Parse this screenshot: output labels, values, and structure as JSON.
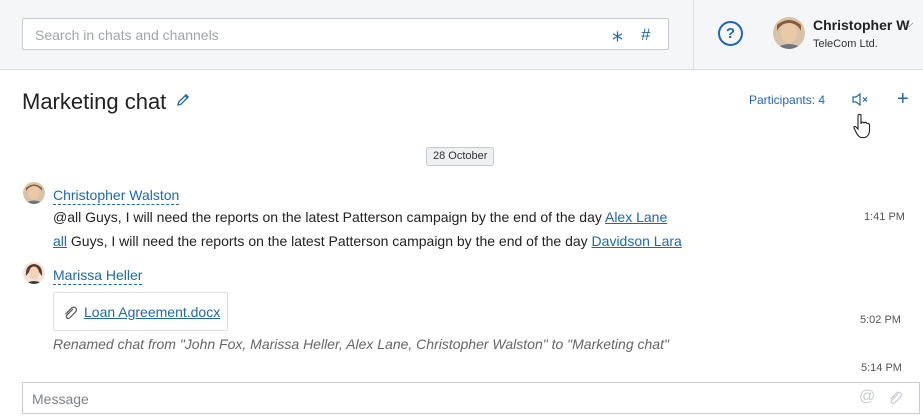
{
  "search": {
    "placeholder": "Search in chats and channels"
  },
  "user": {
    "name": "Christopher W",
    "company": "TeleCom Ltd."
  },
  "chat": {
    "title": "Marketing chat",
    "participants_label": "Participants: 4"
  },
  "date_separator": "28 October",
  "messages": [
    {
      "author": "Christopher Walston",
      "lines": [
        {
          "text": "@all Guys, I will need the reports on the latest Patterson campaign by the end of the day ",
          "mention": "Alex Lane",
          "time": "1:41 PM"
        },
        {
          "lead_mention": "all",
          "text": " Guys, I will need the reports on the latest Patterson campaign by the end of the day ",
          "mention": "Davidson Lara"
        }
      ]
    },
    {
      "author": "Marissa Heller",
      "file": {
        "name": "Loan Agreement.docx",
        "time": "5:02 PM"
      },
      "system": {
        "text": "Renamed chat from \"John Fox, Marissa Heller, Alex Lane, Christopher Walston\" to \"Marketing chat\"",
        "time": "5:14 PM"
      }
    }
  ],
  "composer": {
    "placeholder": "Message"
  },
  "icons": {
    "search_star": "asterisk-icon",
    "search_hash": "hashtag-icon",
    "help": "help-icon",
    "edit": "pencil-icon",
    "mute": "speaker-mute-icon",
    "add": "plus-icon",
    "cursor": "hand-cursor-icon",
    "attach": "paperclip-icon",
    "mention": "at-icon"
  },
  "colors": {
    "accent": "#2067b0",
    "topbar_bg": "#f5f6f7"
  }
}
